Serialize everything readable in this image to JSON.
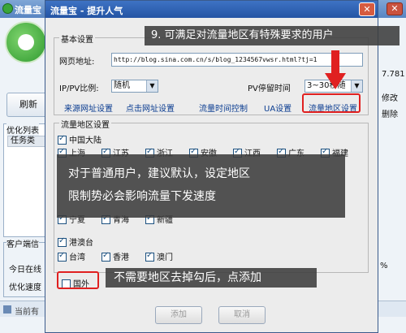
{
  "main_window": {
    "title": "流量宝",
    "close": "✕",
    "refresh": "刷新",
    "opt_list_title": "优化列表",
    "task_header": "任务类",
    "client_title": "客户端信",
    "today_label": "今日在线",
    "speed_label": "优化速度",
    "status_text": "当前有",
    "right_num": "7.781",
    "right_btn1": "修改",
    "right_btn2": "删除",
    "percent": "%"
  },
  "dialog": {
    "title": "流量宝 - 提升人气",
    "close": "✕",
    "basic_group": "基本设置",
    "url_label": "网页地址:",
    "url_value": "http://blog.sina.com.cn/s/blog_1234567vwsr.html?tj=1",
    "ip_pv_label": "IP/PV比例:",
    "ip_pv_value": "随机",
    "pv_time_label": "PV停留时间",
    "pv_time_value": "3~30秒随",
    "links": [
      "来源网址设置",
      "点击网址设置",
      "流量时间控制",
      "UA设置",
      "流量地区设置"
    ],
    "region_group": "流量地区设置",
    "region_mainland": "中国大陆",
    "provinces_row1": [
      "上海",
      "江苏",
      "浙江",
      "安徽",
      "江西",
      "广东",
      "福建"
    ],
    "provinces_row5": [
      "宁夏",
      "青海",
      "新疆"
    ],
    "region_hmt": "港澳台",
    "hmt": [
      "台湾",
      "香港",
      "澳门"
    ],
    "foreign": "国外",
    "add_button": "添加",
    "cancel_button": "取消"
  },
  "annotations": {
    "top": "9. 可满足对流量地区有特殊要求的用户",
    "mid_line1": "对于普通用户，建议默认，设定地区",
    "mid_line2": "限制势必会影响流量下发速度",
    "bottom": "不需要地区去掉勾后，点添加"
  },
  "colors": {
    "dialog_title": "#2454a4",
    "highlight": "#e02020",
    "overlay": "#3c3c3c"
  }
}
